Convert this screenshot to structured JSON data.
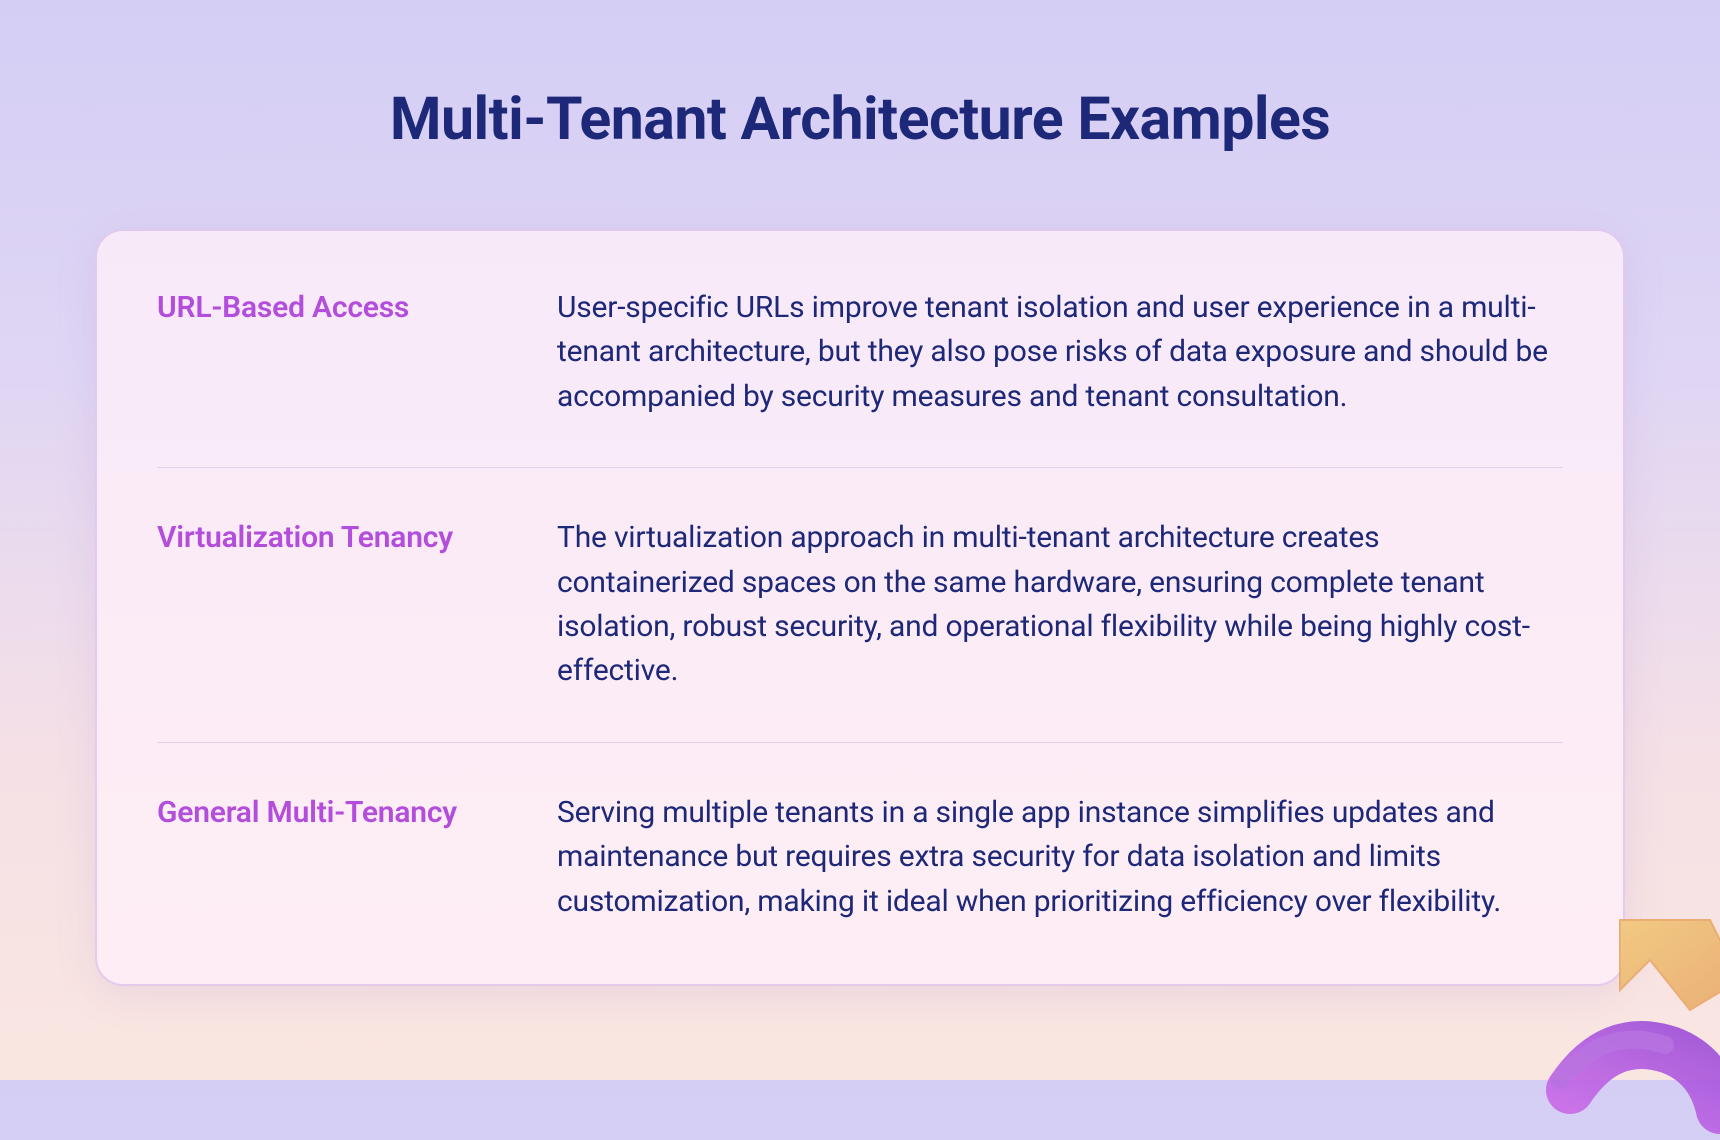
{
  "title": "Multi-Tenant Architecture Examples",
  "examples": [
    {
      "label": "URL-Based Access",
      "body": "User-specific URLs improve tenant isolation and user experience in a multi-tenant architecture, but they also pose risks of data exposure and should be accompanied by security measures and tenant consultation."
    },
    {
      "label": "Virtualization Tenancy",
      "body": "The virtualization approach in multi-tenant architecture creates containerized spaces on the same hardware, ensuring complete tenant isolation, robust security, and operational flexibility while being highly cost-effective."
    },
    {
      "label": "General Multi-Tenancy",
      "body": "Serving multiple tenants in a single app instance simplifies updates and maintenance but requires extra security for data isolation and limits customization, making it ideal when prioritizing efficiency over flexibility."
    }
  ]
}
